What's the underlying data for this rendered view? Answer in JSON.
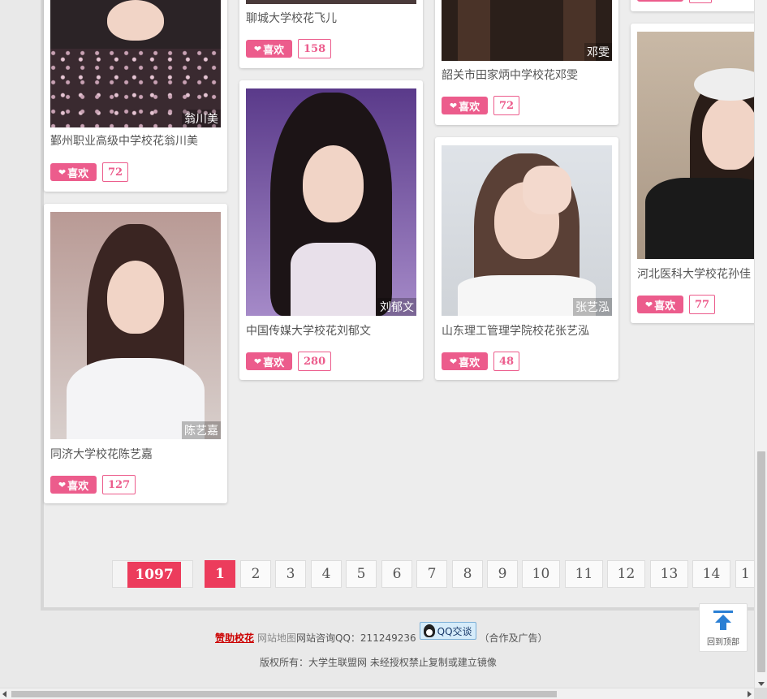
{
  "cards": [
    {
      "title": "鄞州职业高级中学校花翁川美",
      "photo_name": "翁川美",
      "like_label": "喜欢",
      "likes": "72"
    },
    {
      "title": "同济大学校花陈艺嘉",
      "photo_name": "陈艺嘉",
      "like_label": "喜欢",
      "likes": "127"
    },
    {
      "title": "聊城大学校花飞儿",
      "photo_name": "",
      "like_label": "喜欢",
      "likes": "158"
    },
    {
      "title": "中国传媒大学校花刘郁文",
      "photo_name": "刘郁文",
      "like_label": "喜欢",
      "likes": "280"
    },
    {
      "title": "韶关市田家炳中学校花邓雯",
      "photo_name": "邓雯",
      "like_label": "喜欢",
      "likes": "72"
    },
    {
      "title": "山东理工管理学院校花张艺泓",
      "photo_name": "张艺泓",
      "like_label": "喜欢",
      "likes": "48"
    },
    {
      "title": "河北医科大学校花孙佳",
      "photo_name": "",
      "like_label": "喜欢",
      "likes": "77"
    }
  ],
  "pagination": {
    "total": "1097",
    "pages": [
      "1",
      "2",
      "3",
      "4",
      "5",
      "6",
      "7",
      "8",
      "9",
      "10",
      "11",
      "12",
      "13",
      "14",
      "1"
    ],
    "current": "1"
  },
  "footer": {
    "sponsor": "赞助校花",
    "sitemap": "网站地图",
    "consult": "网站咨询QQ：211249236",
    "qq_button": "QQ交谈",
    "ads": "（合作及广告）",
    "copyright": "版权所有：大学生联盟网 未经授权禁止复制或建立镜像"
  },
  "back_to_top": "回到顶部",
  "colors": {
    "accent": "#ec5c8c",
    "pager_active": "#ec3c5c",
    "link_red": "#cc0000"
  }
}
